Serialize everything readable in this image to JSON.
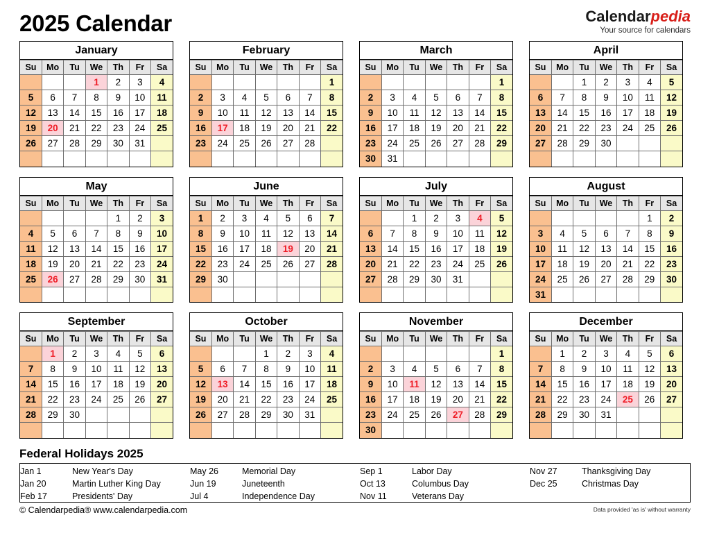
{
  "header": {
    "title": "2025 Calendar",
    "brand_primary": "Calendar",
    "brand_secondary": "pedia",
    "tagline": "Your source for calendars"
  },
  "colors": {
    "sunday_bg": "#fac090",
    "saturday_bg": "#fafac8",
    "weekday_header_bg": "#e6e6e6",
    "holiday_bg": "#fbd3d9",
    "holiday_text": "#ef1c26",
    "brand_accent": "#d81f19"
  },
  "weekdays": [
    "Su",
    "Mo",
    "Tu",
    "We",
    "Th",
    "Fr",
    "Sa"
  ],
  "months": [
    {
      "name": "January",
      "weeks": [
        [
          "",
          "",
          "",
          "1",
          "2",
          "3",
          "4"
        ],
        [
          "5",
          "6",
          "7",
          "8",
          "9",
          "10",
          "11"
        ],
        [
          "12",
          "13",
          "14",
          "15",
          "16",
          "17",
          "18"
        ],
        [
          "19",
          "20",
          "21",
          "22",
          "23",
          "24",
          "25"
        ],
        [
          "26",
          "27",
          "28",
          "29",
          "30",
          "31",
          ""
        ],
        [
          "",
          "",
          "",
          "",
          "",
          "",
          ""
        ]
      ],
      "holidays": [
        1,
        20
      ]
    },
    {
      "name": "February",
      "weeks": [
        [
          "",
          "",
          "",
          "",
          "",
          "",
          "1"
        ],
        [
          "2",
          "3",
          "4",
          "5",
          "6",
          "7",
          "8"
        ],
        [
          "9",
          "10",
          "11",
          "12",
          "13",
          "14",
          "15"
        ],
        [
          "16",
          "17",
          "18",
          "19",
          "20",
          "21",
          "22"
        ],
        [
          "23",
          "24",
          "25",
          "26",
          "27",
          "28",
          ""
        ],
        [
          "",
          "",
          "",
          "",
          "",
          "",
          ""
        ]
      ],
      "holidays": [
        17
      ]
    },
    {
      "name": "March",
      "weeks": [
        [
          "",
          "",
          "",
          "",
          "",
          "",
          "1"
        ],
        [
          "2",
          "3",
          "4",
          "5",
          "6",
          "7",
          "8"
        ],
        [
          "9",
          "10",
          "11",
          "12",
          "13",
          "14",
          "15"
        ],
        [
          "16",
          "17",
          "18",
          "19",
          "20",
          "21",
          "22"
        ],
        [
          "23",
          "24",
          "25",
          "26",
          "27",
          "28",
          "29"
        ],
        [
          "30",
          "31",
          "",
          "",
          "",
          "",
          ""
        ]
      ],
      "holidays": []
    },
    {
      "name": "April",
      "weeks": [
        [
          "",
          "",
          "1",
          "2",
          "3",
          "4",
          "5"
        ],
        [
          "6",
          "7",
          "8",
          "9",
          "10",
          "11",
          "12"
        ],
        [
          "13",
          "14",
          "15",
          "16",
          "17",
          "18",
          "19"
        ],
        [
          "20",
          "21",
          "22",
          "23",
          "24",
          "25",
          "26"
        ],
        [
          "27",
          "28",
          "29",
          "30",
          "",
          "",
          ""
        ],
        [
          "",
          "",
          "",
          "",
          "",
          "",
          ""
        ]
      ],
      "holidays": []
    },
    {
      "name": "May",
      "weeks": [
        [
          "",
          "",
          "",
          "",
          "1",
          "2",
          "3"
        ],
        [
          "4",
          "5",
          "6",
          "7",
          "8",
          "9",
          "10"
        ],
        [
          "11",
          "12",
          "13",
          "14",
          "15",
          "16",
          "17"
        ],
        [
          "18",
          "19",
          "20",
          "21",
          "22",
          "23",
          "24"
        ],
        [
          "25",
          "26",
          "27",
          "28",
          "29",
          "30",
          "31"
        ],
        [
          "",
          "",
          "",
          "",
          "",
          "",
          ""
        ]
      ],
      "holidays": [
        26
      ]
    },
    {
      "name": "June",
      "weeks": [
        [
          "1",
          "2",
          "3",
          "4",
          "5",
          "6",
          "7"
        ],
        [
          "8",
          "9",
          "10",
          "11",
          "12",
          "13",
          "14"
        ],
        [
          "15",
          "16",
          "17",
          "18",
          "19",
          "20",
          "21"
        ],
        [
          "22",
          "23",
          "24",
          "25",
          "26",
          "27",
          "28"
        ],
        [
          "29",
          "30",
          "",
          "",
          "",
          "",
          ""
        ],
        [
          "",
          "",
          "",
          "",
          "",
          "",
          ""
        ]
      ],
      "holidays": [
        19
      ]
    },
    {
      "name": "July",
      "weeks": [
        [
          "",
          "",
          "1",
          "2",
          "3",
          "4",
          "5"
        ],
        [
          "6",
          "7",
          "8",
          "9",
          "10",
          "11",
          "12"
        ],
        [
          "13",
          "14",
          "15",
          "16",
          "17",
          "18",
          "19"
        ],
        [
          "20",
          "21",
          "22",
          "23",
          "24",
          "25",
          "26"
        ],
        [
          "27",
          "28",
          "29",
          "30",
          "31",
          "",
          ""
        ],
        [
          "",
          "",
          "",
          "",
          "",
          "",
          ""
        ]
      ],
      "holidays": [
        4
      ]
    },
    {
      "name": "August",
      "weeks": [
        [
          "",
          "",
          "",
          "",
          "",
          "1",
          "2"
        ],
        [
          "3",
          "4",
          "5",
          "6",
          "7",
          "8",
          "9"
        ],
        [
          "10",
          "11",
          "12",
          "13",
          "14",
          "15",
          "16"
        ],
        [
          "17",
          "18",
          "19",
          "20",
          "21",
          "22",
          "23"
        ],
        [
          "24",
          "25",
          "26",
          "27",
          "28",
          "29",
          "30"
        ],
        [
          "31",
          "",
          "",
          "",
          "",
          "",
          ""
        ]
      ],
      "holidays": []
    },
    {
      "name": "September",
      "weeks": [
        [
          "",
          "1",
          "2",
          "3",
          "4",
          "5",
          "6"
        ],
        [
          "7",
          "8",
          "9",
          "10",
          "11",
          "12",
          "13"
        ],
        [
          "14",
          "15",
          "16",
          "17",
          "18",
          "19",
          "20"
        ],
        [
          "21",
          "22",
          "23",
          "24",
          "25",
          "26",
          "27"
        ],
        [
          "28",
          "29",
          "30",
          "",
          "",
          "",
          ""
        ],
        [
          "",
          "",
          "",
          "",
          "",
          "",
          ""
        ]
      ],
      "holidays": [
        1
      ]
    },
    {
      "name": "October",
      "weeks": [
        [
          "",
          "",
          "",
          "1",
          "2",
          "3",
          "4"
        ],
        [
          "5",
          "6",
          "7",
          "8",
          "9",
          "10",
          "11"
        ],
        [
          "12",
          "13",
          "14",
          "15",
          "16",
          "17",
          "18"
        ],
        [
          "19",
          "20",
          "21",
          "22",
          "23",
          "24",
          "25"
        ],
        [
          "26",
          "27",
          "28",
          "29",
          "30",
          "31",
          ""
        ],
        [
          "",
          "",
          "",
          "",
          "",
          "",
          ""
        ]
      ],
      "holidays": [
        13
      ]
    },
    {
      "name": "November",
      "weeks": [
        [
          "",
          "",
          "",
          "",
          "",
          "",
          "1"
        ],
        [
          "2",
          "3",
          "4",
          "5",
          "6",
          "7",
          "8"
        ],
        [
          "9",
          "10",
          "11",
          "12",
          "13",
          "14",
          "15"
        ],
        [
          "16",
          "17",
          "18",
          "19",
          "20",
          "21",
          "22"
        ],
        [
          "23",
          "24",
          "25",
          "26",
          "27",
          "28",
          "29"
        ],
        [
          "30",
          "",
          "",
          "",
          "",
          "",
          ""
        ]
      ],
      "holidays": [
        11,
        27
      ]
    },
    {
      "name": "December",
      "weeks": [
        [
          "",
          "1",
          "2",
          "3",
          "4",
          "5",
          "6"
        ],
        [
          "7",
          "8",
          "9",
          "10",
          "11",
          "12",
          "13"
        ],
        [
          "14",
          "15",
          "16",
          "17",
          "18",
          "19",
          "20"
        ],
        [
          "21",
          "22",
          "23",
          "24",
          "25",
          "26",
          "27"
        ],
        [
          "28",
          "29",
          "30",
          "31",
          "",
          "",
          ""
        ],
        [
          "",
          "",
          "",
          "",
          "",
          "",
          ""
        ]
      ],
      "holidays": [
        25
      ]
    }
  ],
  "holidays_section": {
    "title": "Federal Holidays 2025",
    "columns": [
      [
        {
          "date": "Jan 1",
          "name": "New Year's Day"
        },
        {
          "date": "Jan 20",
          "name": "Martin Luther King Day"
        },
        {
          "date": "Feb 17",
          "name": "Presidents' Day"
        }
      ],
      [
        {
          "date": "May 26",
          "name": "Memorial Day"
        },
        {
          "date": "Jun 19",
          "name": "Juneteenth"
        },
        {
          "date": "Jul 4",
          "name": "Independence Day"
        }
      ],
      [
        {
          "date": "Sep 1",
          "name": "Labor Day"
        },
        {
          "date": "Oct 13",
          "name": "Columbus Day"
        },
        {
          "date": "Nov 11",
          "name": "Veterans Day"
        }
      ],
      [
        {
          "date": "Nov 27",
          "name": "Thanksgiving Day"
        },
        {
          "date": "Dec 25",
          "name": "Christmas Day"
        },
        {
          "date": "",
          "name": ""
        }
      ]
    ]
  },
  "footer": {
    "copyright": "© Calendarpedia®   www.calendarpedia.com",
    "disclaimer": "Data provided 'as is' without warranty"
  }
}
